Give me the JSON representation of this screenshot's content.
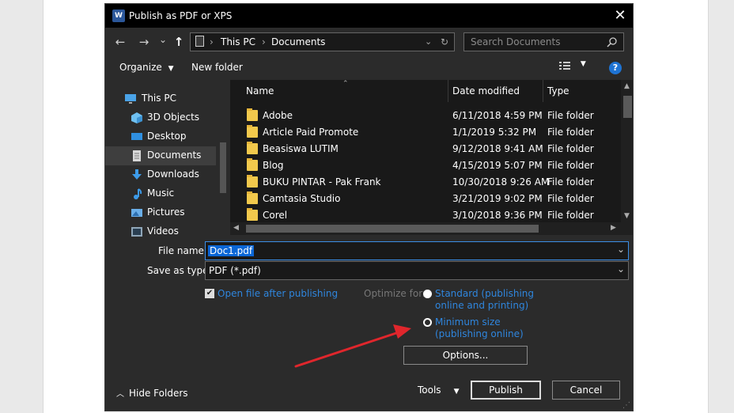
{
  "dialog": {
    "title": "Publish as PDF or XPS",
    "icon_letter": "W",
    "close": "✕"
  },
  "nav": {
    "back": "←",
    "forward": "→",
    "recent": "⌄",
    "up": "↑",
    "path": [
      "This PC",
      "Documents"
    ],
    "refresh": "↻",
    "search_placeholder": "Search Documents"
  },
  "toolbar": {
    "organize": "Organize",
    "new_folder": "New folder",
    "help": "?"
  },
  "sidebar": {
    "items": [
      {
        "label": "This PC",
        "icon": "computer-icon"
      },
      {
        "label": "3D Objects",
        "icon": "cube-icon"
      },
      {
        "label": "Desktop",
        "icon": "desktop-icon"
      },
      {
        "label": "Documents",
        "icon": "document-icon"
      },
      {
        "label": "Downloads",
        "icon": "download-icon"
      },
      {
        "label": "Music",
        "icon": "music-icon"
      },
      {
        "label": "Pictures",
        "icon": "pictures-icon"
      },
      {
        "label": "Videos",
        "icon": "video-icon"
      }
    ]
  },
  "files": {
    "columns": {
      "name": "Name",
      "date": "Date modified",
      "type": "Type"
    },
    "rows": [
      {
        "name": "Adobe",
        "date": "6/11/2018 4:59 PM",
        "type": "File folder"
      },
      {
        "name": "Article Paid Promote",
        "date": "1/1/2019 5:32 PM",
        "type": "File folder"
      },
      {
        "name": "Beasiswa LUTIM",
        "date": "9/12/2018 9:41 AM",
        "type": "File folder"
      },
      {
        "name": "Blog",
        "date": "4/15/2019 5:07 PM",
        "type": "File folder"
      },
      {
        "name": "BUKU PINTAR - Pak Frank",
        "date": "10/30/2018 9:26 AM",
        "type": "File folder"
      },
      {
        "name": "Camtasia Studio",
        "date": "3/21/2019 9:02 PM",
        "type": "File folder"
      },
      {
        "name": "Corel",
        "date": "3/10/2018 9:36 PM",
        "type": "File folder"
      }
    ]
  },
  "form": {
    "file_name_label": "File name:",
    "file_name_value": "Doc1.pdf",
    "save_type_label": "Save as type:",
    "save_type_value": "PDF (*.pdf)",
    "open_after_label": "Open file after publishing",
    "optimize_label": "Optimize for:",
    "standard_line1": "Standard (publishing",
    "standard_line2": "online and printing)",
    "minimum_line1": "Minimum size",
    "minimum_line2": "(publishing online)",
    "options_button": "Options..."
  },
  "footer": {
    "hide_folders": "Hide Folders",
    "tools": "Tools",
    "publish": "Publish",
    "cancel": "Cancel"
  },
  "colors": {
    "accent": "#2f86de",
    "annotation_arrow": "#e0262c"
  }
}
